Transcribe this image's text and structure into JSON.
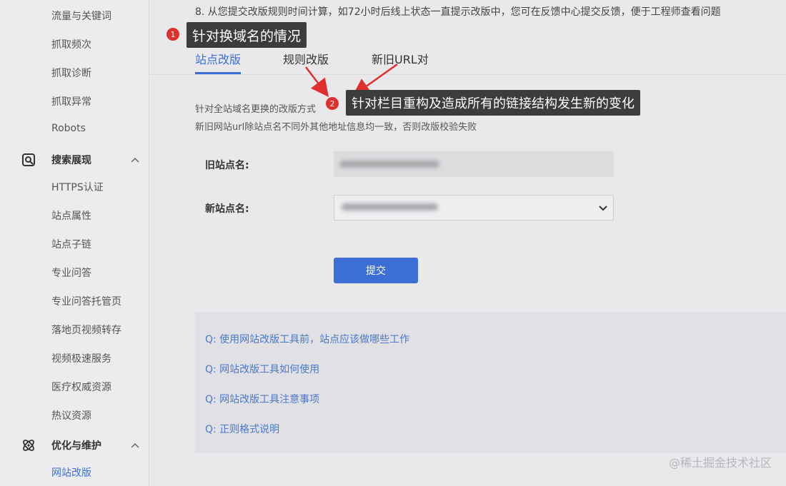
{
  "sidebar": {
    "top_items": [
      {
        "label": "流量与关键词"
      },
      {
        "label": "抓取频次"
      },
      {
        "label": "抓取诊断"
      },
      {
        "label": "抓取异常"
      },
      {
        "label": "Robots"
      }
    ],
    "groups": [
      {
        "label": "搜索展现",
        "icon": "search-display-icon",
        "items": [
          {
            "label": "HTTPS认证"
          },
          {
            "label": "站点属性"
          },
          {
            "label": "站点子链"
          },
          {
            "label": "专业问答"
          },
          {
            "label": "专业问答托管页"
          },
          {
            "label": "落地页视频转存"
          },
          {
            "label": "视频极速服务"
          },
          {
            "label": "医疗权威资源"
          },
          {
            "label": "热议资源"
          }
        ]
      },
      {
        "label": "优化与维护",
        "icon": "atom-icon",
        "items": [
          {
            "label": "网站改版",
            "active": true
          }
        ]
      }
    ]
  },
  "main": {
    "notice": "8. 从您提交改版规则时间计算，如72小时后线上状态一直提示改版中，您可在反馈中心提交反馈，便于工程师查看问题",
    "tabs": [
      {
        "label": "站点改版",
        "active": true
      },
      {
        "label": "规则改版"
      },
      {
        "label": "新旧URL对"
      }
    ],
    "desc_line1": "针对全站域名更换的改版方式",
    "desc_line2": "新旧网站url除站点名不同外其他地址信息均一致，否则改版校验失败",
    "form": {
      "old_site_label": "旧站点名:",
      "new_site_label": "新站点名:",
      "submit_label": "提交"
    },
    "faq": [
      {
        "label": "Q:  使用网站改版工具前，站点应该做哪些工作"
      },
      {
        "label": "Q:  网站改版工具如何使用"
      },
      {
        "label": "Q:  网站改版工具注意事项"
      },
      {
        "label": "Q:  正则格式说明"
      }
    ]
  },
  "annotations": {
    "one": {
      "number": "1",
      "text": "针对换域名的情况"
    },
    "two": {
      "number": "2",
      "text": "针对栏目重构及造成所有的链接结构发生新的变化"
    },
    "badge_color": "#e0302e",
    "arrow_color": "#e0302e"
  },
  "watermark": "@稀土掘金技术社区",
  "colors": {
    "accent": "#3a6fd6",
    "link": "#4a78c8"
  }
}
